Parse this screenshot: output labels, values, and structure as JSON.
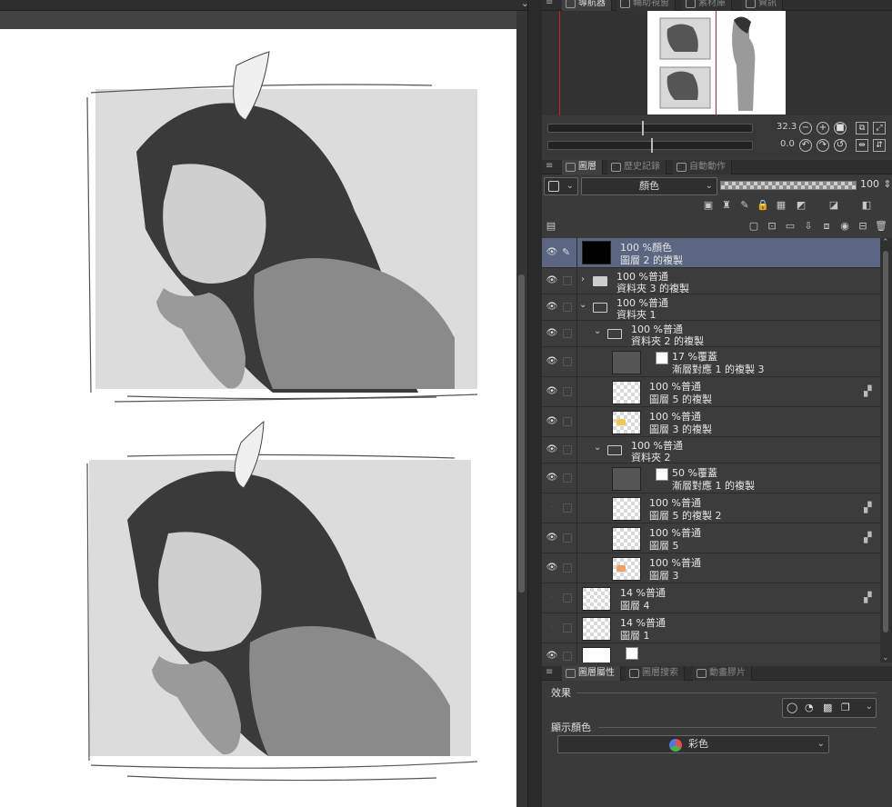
{
  "navigator": {
    "tabs": [
      "導航器",
      "輔助視窗",
      "素材庫",
      "資訊"
    ],
    "zoom": "32.3",
    "rotation": "0.0"
  },
  "layer_panel": {
    "tabs": [
      "圖層",
      "歷史記錄",
      "自動動作"
    ],
    "blend_mode": "顏色",
    "opacity": "100",
    "layers": [
      {
        "top": "100 %顏色",
        "name": "圖層 2 的複製",
        "selected": true
      },
      {
        "top": "100 %普通",
        "name": "資料夾 3 的複製"
      },
      {
        "top": "100 %普通",
        "name": "資料夾 1"
      },
      {
        "top": "100 %普通",
        "name": "資料夾 2 的複製"
      },
      {
        "top": "17 %覆蓋",
        "name": "漸層對應 1 的複製 3"
      },
      {
        "top": "100 %普通",
        "name": "圖層 5 的複製"
      },
      {
        "top": "100 %普通",
        "name": "圖層 3 的複製"
      },
      {
        "top": "100 %普通",
        "name": "資料夾 2"
      },
      {
        "top": "50 %覆蓋",
        "name": "漸層對應 1 的複製"
      },
      {
        "top": "100 %普通",
        "name": "圖層 5 的複製 2"
      },
      {
        "top": "100 %普通",
        "name": "圖層 5"
      },
      {
        "top": "100 %普通",
        "name": "圖層 3"
      },
      {
        "top": "14 %普通",
        "name": "圖層 4"
      },
      {
        "top": "14 %普通",
        "name": "圖層 1"
      }
    ]
  },
  "property_panel": {
    "tabs": [
      "圖層屬性",
      "圖層搜索",
      "動畫膠片"
    ],
    "effect_label": "效果",
    "display_color_label": "顯示顏色",
    "display_color_value": "彩色"
  }
}
